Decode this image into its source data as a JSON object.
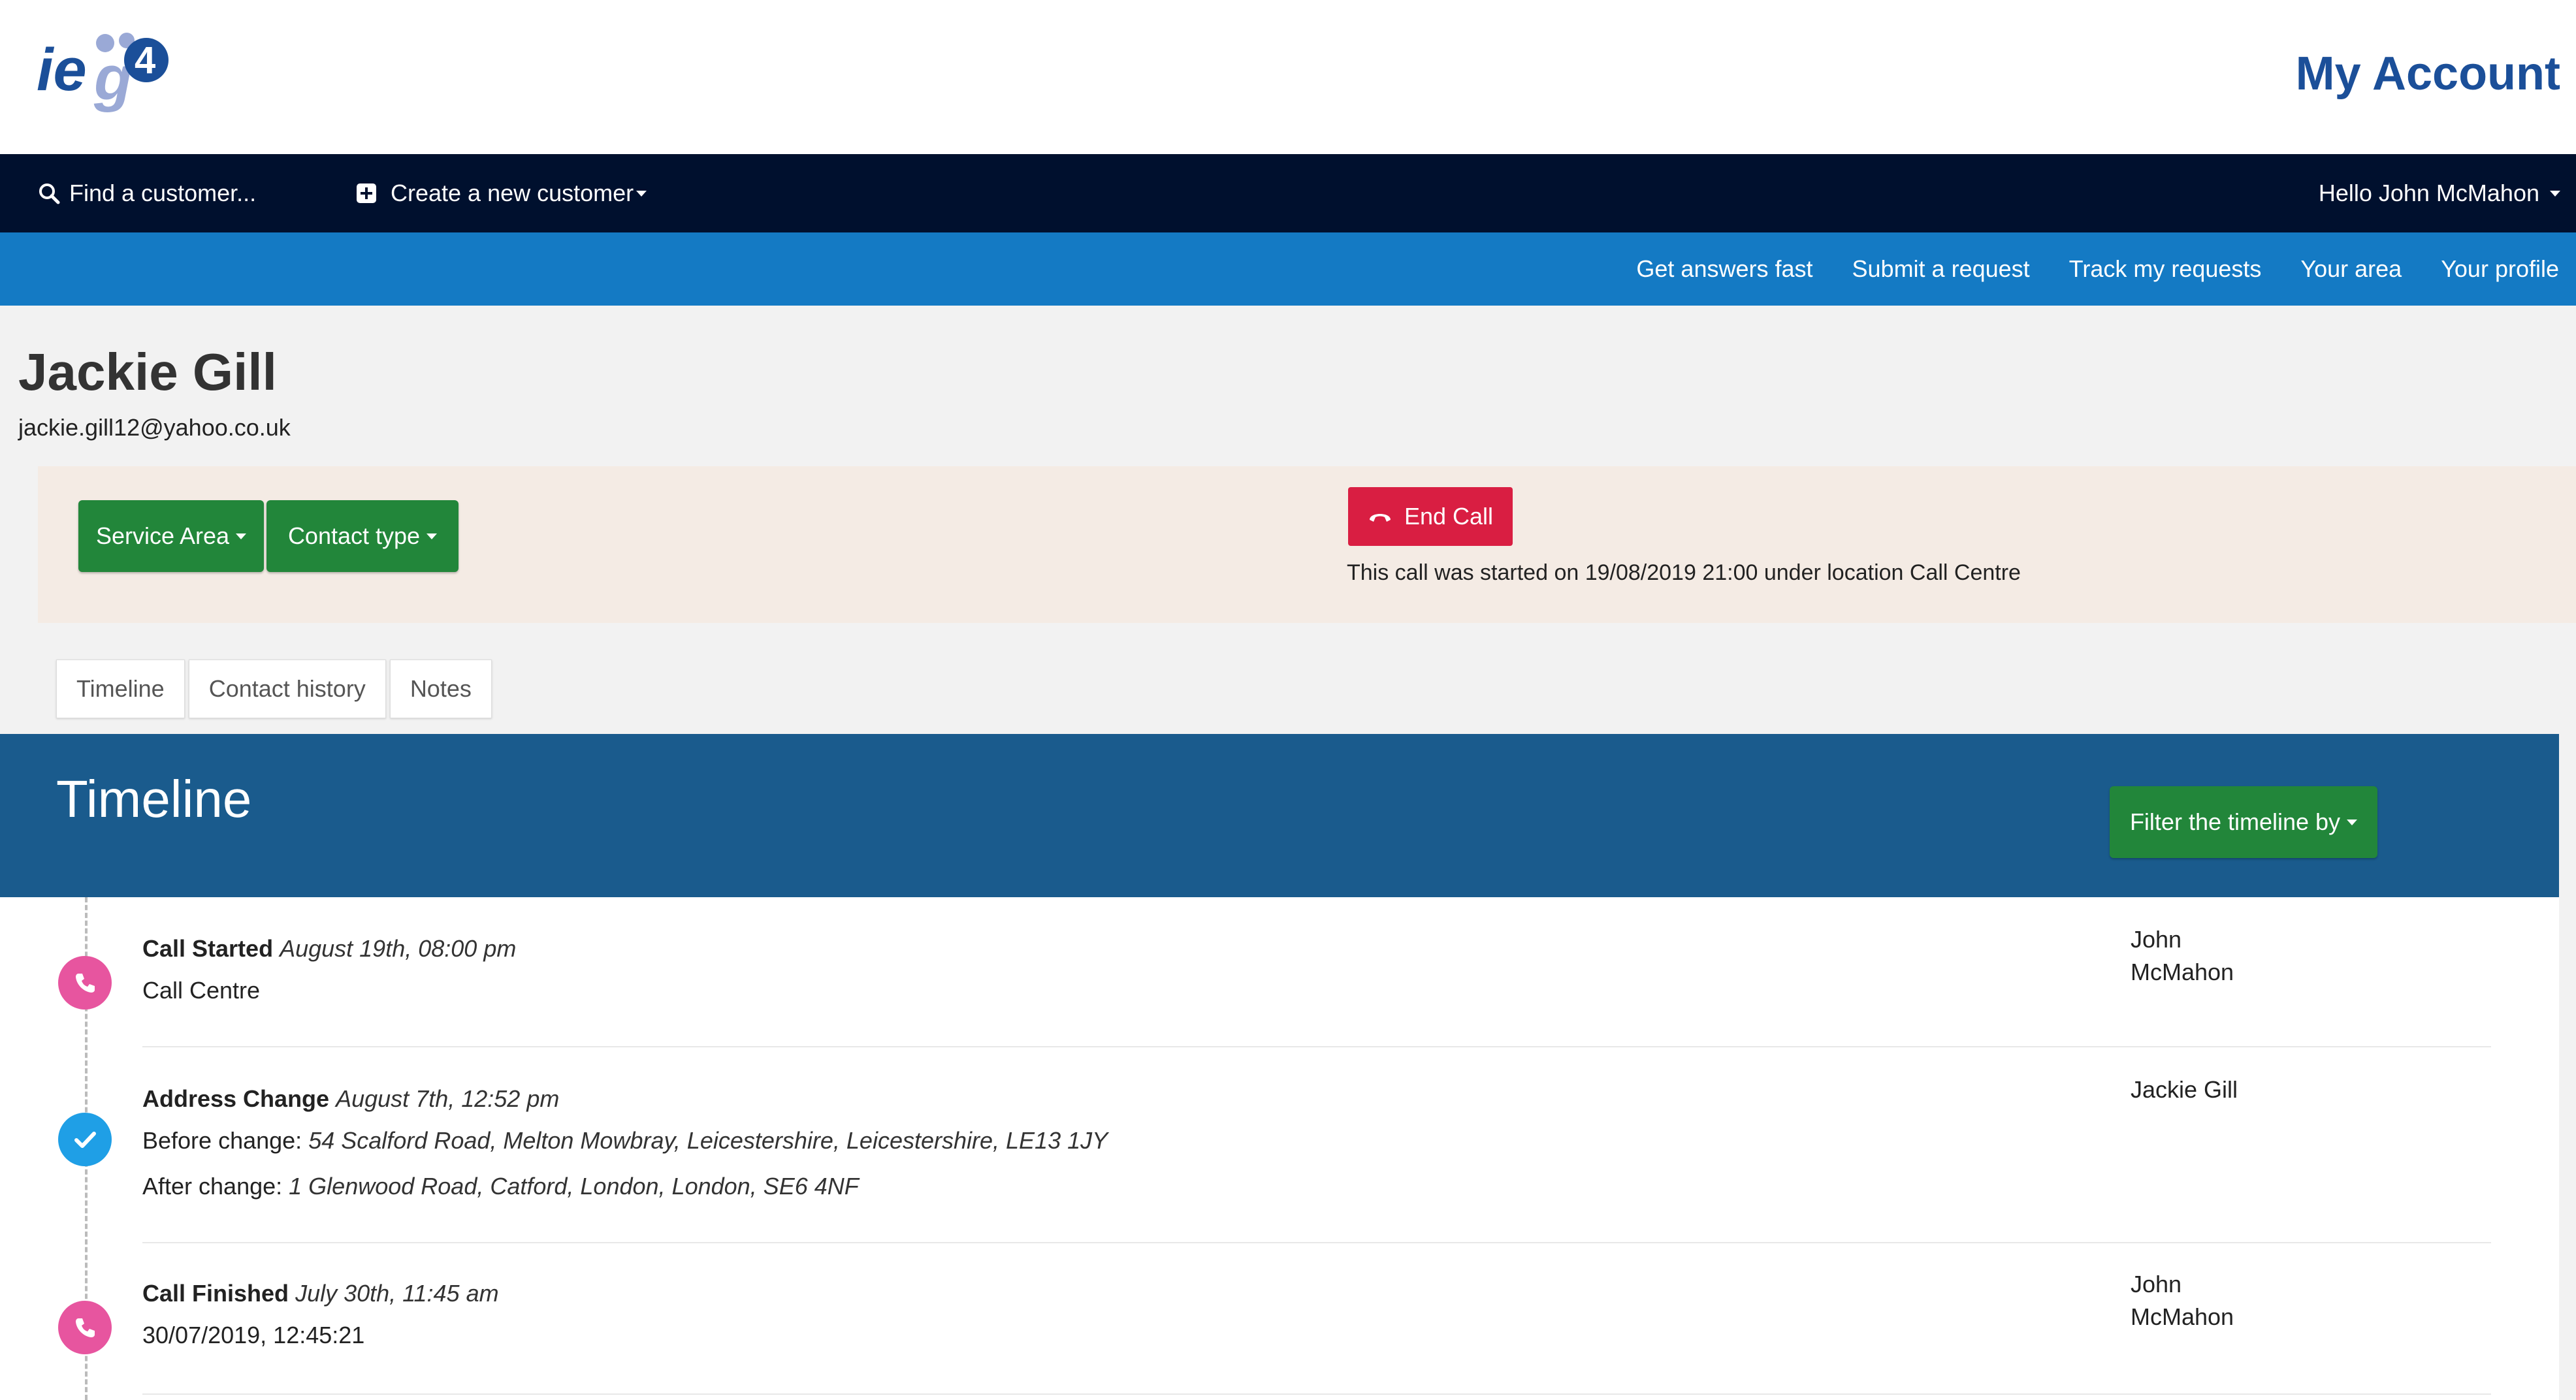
{
  "header": {
    "logo_text": "ieg4",
    "title": "My Account"
  },
  "top_nav": {
    "find_customer": "Find a customer...",
    "create_customer": "Create a new customer",
    "greeting": "Hello John McMahon"
  },
  "sub_nav": {
    "items": [
      {
        "label": "Get answers fast"
      },
      {
        "label": "Submit a request"
      },
      {
        "label": "Track my requests"
      },
      {
        "label": "Your area"
      },
      {
        "label": "Your profile"
      }
    ]
  },
  "customer": {
    "name": "Jackie Gill",
    "email": "jackie.gill12@yahoo.co.uk"
  },
  "call_panel": {
    "service_area_label": "Service Area",
    "contact_type_label": "Contact type",
    "end_call_label": "End Call",
    "call_info": "This call was started on 19/08/2019 21:00 under location Call Centre"
  },
  "tabs": [
    {
      "label": "Timeline"
    },
    {
      "label": "Contact history"
    },
    {
      "label": "Notes"
    }
  ],
  "timeline": {
    "title": "Timeline",
    "filter_label": "Filter the timeline by",
    "events": [
      {
        "type": "Call Started",
        "date": "August 19th, 08:00 pm",
        "line1": "Call Centre",
        "user_line1": "John",
        "user_line2": "McMahon",
        "icon": "phone-icon",
        "color": "#e7559f"
      },
      {
        "type": "Address Change",
        "date": "August 7th, 12:52 pm",
        "before_label": "Before change:",
        "before_value": "54 Scalford Road, Melton Mowbray, Leicestershire, Leicestershire, LE13 1JY",
        "after_label": "After change:",
        "after_value": "1 Glenwood Road, Catford, London, London, SE6 4NF",
        "user": "Jackie Gill",
        "icon": "check-icon",
        "color": "#1f9fe6"
      },
      {
        "type": "Call Finished",
        "date": "July 30th, 11:45 am",
        "line1": "30/07/2019, 12:45:21",
        "user_line1": "John",
        "user_line2": "McMahon",
        "icon": "phone-icon",
        "color": "#e7559f"
      }
    ]
  }
}
